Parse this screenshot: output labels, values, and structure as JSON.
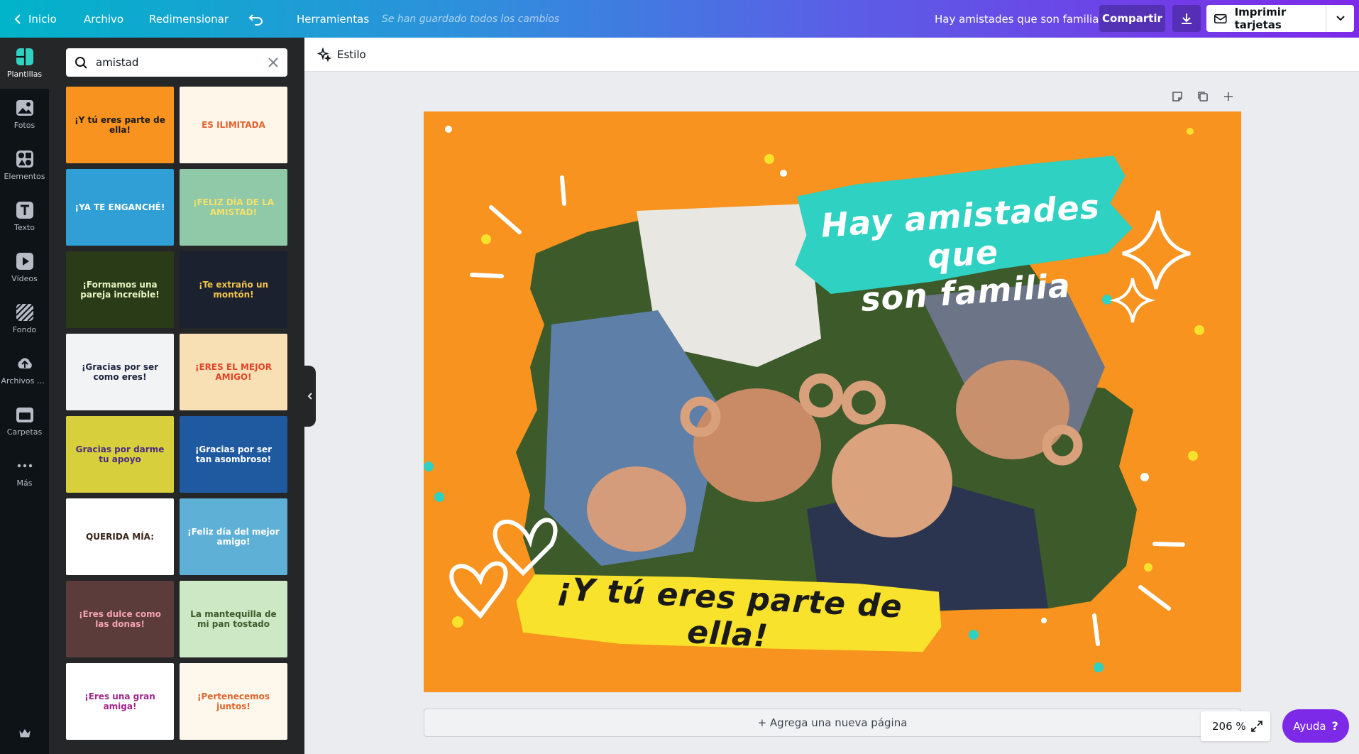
{
  "topbar": {
    "home": "Inicio",
    "file": "Archivo",
    "resize": "Redimensionar",
    "tools": "Herramientas",
    "saved_status": "Se han guardado todos los cambios",
    "doc_title": "Hay amistades que son familia",
    "share": "Compartir",
    "print": "Imprimir tarjetas"
  },
  "sidebar": {
    "items": [
      {
        "label": "Plantillas",
        "icon": "templates-icon"
      },
      {
        "label": "Fotos",
        "icon": "photos-icon"
      },
      {
        "label": "Elementos",
        "icon": "elements-icon"
      },
      {
        "label": "Texto",
        "icon": "text-icon"
      },
      {
        "label": "Vídeos",
        "icon": "videos-icon"
      },
      {
        "label": "Fondo",
        "icon": "background-icon"
      },
      {
        "label": "Archivos su...",
        "icon": "uploads-icon"
      },
      {
        "label": "Carpetas",
        "icon": "folders-icon"
      },
      {
        "label": "Más",
        "icon": "more-icon"
      }
    ]
  },
  "panel": {
    "search_value": "amistad",
    "templates": [
      {
        "text": "¡Y tú eres parte de ella!",
        "bg": "#f7931e",
        "fg": "#1a1a1a"
      },
      {
        "text": "ES ILIMITADA",
        "bg": "#fdf6e9",
        "fg": "#e8602c"
      },
      {
        "text": "¡YA TE ENGANCHÉ!",
        "bg": "#2f9fd6",
        "fg": "#ffffff"
      },
      {
        "text": "¡FELIZ DÍA DE LA AMISTAD!",
        "bg": "#8fc9a8",
        "fg": "#f6e16a"
      },
      {
        "text": "¡Formamos una pareja increíble!",
        "bg": "#2a3b17",
        "fg": "#e8f3c2"
      },
      {
        "text": "¡Te extraño un montón!",
        "bg": "#1c2130",
        "fg": "#f0c34a"
      },
      {
        "text": "¡Gracias por ser como eres!",
        "bg": "#f2f3f5",
        "fg": "#1e2540"
      },
      {
        "text": "¡ERES EL MEJOR AMIGO!",
        "bg": "#f9dfb4",
        "fg": "#e0442a"
      },
      {
        "text": "Gracias por darme tu apoyo",
        "bg": "#d7cf3c",
        "fg": "#4a2c82"
      },
      {
        "text": "¡Gracias por ser tan asombroso!",
        "bg": "#1f5aa0",
        "fg": "#ffffff"
      },
      {
        "text": "QUERIDA MÍA:",
        "bg": "#ffffff",
        "fg": "#3a2418"
      },
      {
        "text": "¡Feliz día del mejor amigo!",
        "bg": "#5fb0d6",
        "fg": "#ffffff"
      },
      {
        "text": "¡Eres dulce como las donas!",
        "bg": "#5b3c3a",
        "fg": "#f4a1b4"
      },
      {
        "text": "La mantequilla de mi pan tostado",
        "bg": "#cde8c4",
        "fg": "#3d5c2c"
      },
      {
        "text": "¡Eres una gran amiga!",
        "bg": "#ffffff",
        "fg": "#a0258a"
      },
      {
        "text": "¡Pertenecemos juntos!",
        "bg": "#fdf7ec",
        "fg": "#e0662c"
      }
    ]
  },
  "toolbar": {
    "style": "Estilo"
  },
  "canvas": {
    "headline_line1": "Hay amistades que",
    "headline_line2": "son familia",
    "subline": "¡Y tú eres parte de ella!",
    "bg_color": "#f7931e",
    "title_brush_color": "#2ed1c2",
    "subtitle_brush_color": "#f8e22b"
  },
  "add_page": "+ Agrega una nueva página",
  "zoom": "206 %",
  "help": "Ayuda"
}
